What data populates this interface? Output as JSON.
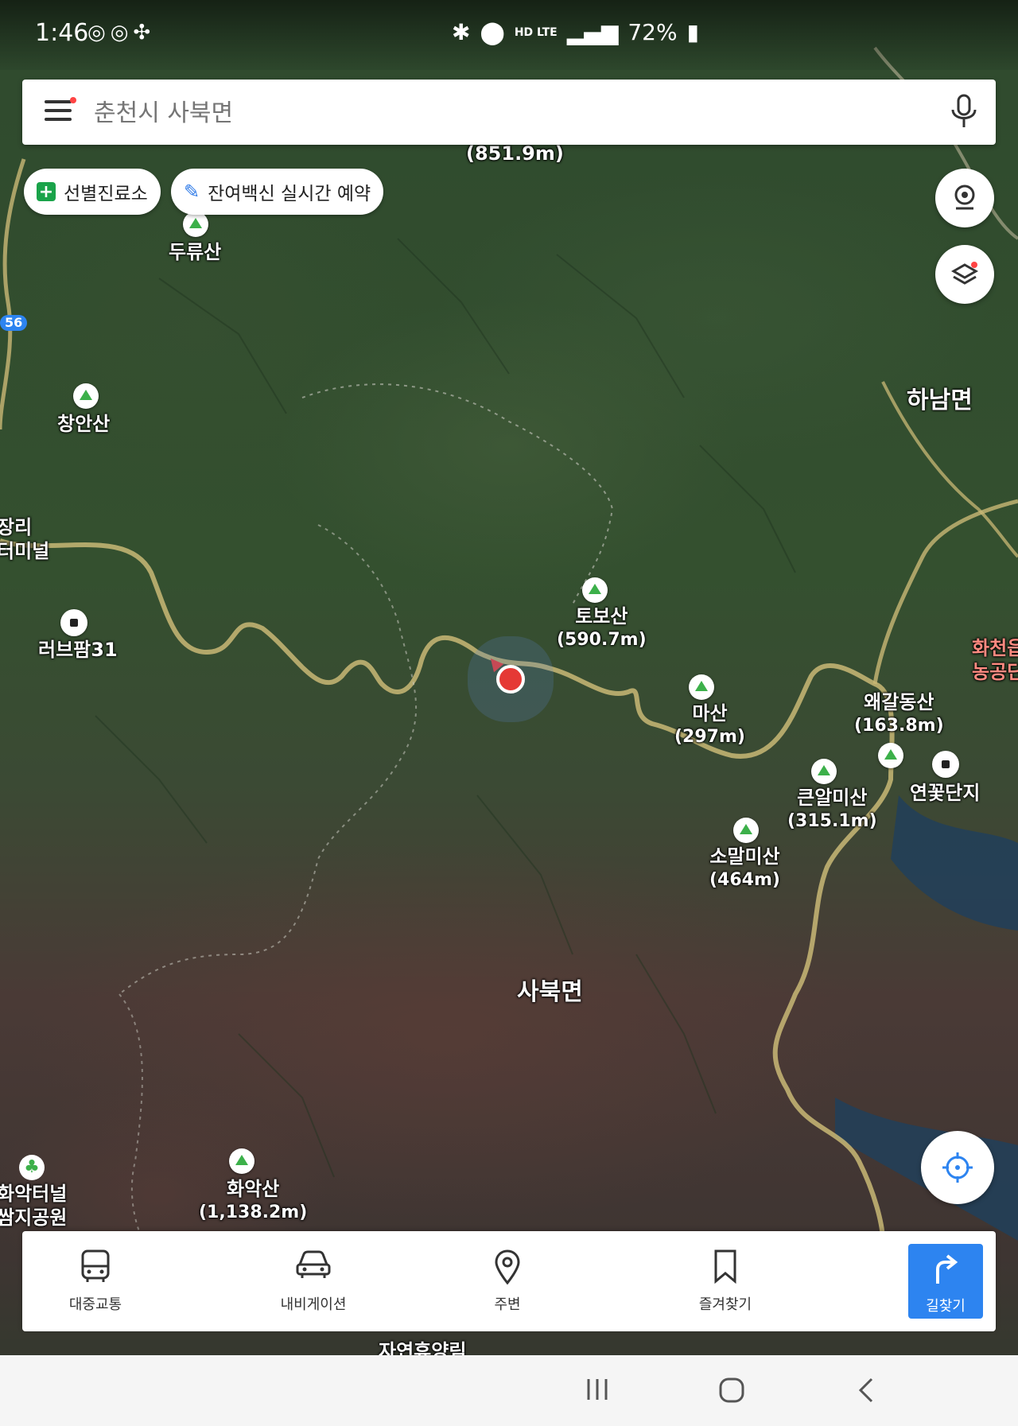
{
  "status_bar": {
    "time": "1:46",
    "left_icons": [
      "instagram-icon",
      "instagram-icon",
      "fan-icon"
    ],
    "network": "HD LTE",
    "battery": "72%"
  },
  "search": {
    "placeholder": "춘천시 사북면"
  },
  "chips": [
    {
      "label": "선별진료소",
      "icon": "plus-square-icon",
      "color": "#1aa34a"
    },
    {
      "label": "잔여백신 실시간 예약",
      "icon": "syringe-icon",
      "color": "#2f7be8"
    }
  ],
  "map_labels": {
    "top_peak_partial": "(851.9m)",
    "duryusan": "두류산",
    "changansan": "창안산",
    "hanam": "하남면",
    "terminal_partial_1": "장리",
    "terminal_partial_2": "터미널",
    "route_badge": "56",
    "lovefarm": "러브팜31",
    "tobosan": "토보산",
    "tobosan_elev": "(590.7m)",
    "masan": "마산",
    "masan_elev": "(297m)",
    "waegaldongsan": "왜갈동산",
    "waegaldongsan_elev": "(163.8m)",
    "hwacheon_partial_1": "화천읍",
    "hwacheon_partial_2": "농공단",
    "yeonkkot": "연꽃단지",
    "keunalmisan": "큰알미산",
    "keunalmisan_elev": "(315.1m)",
    "somalmisan": "소말미산",
    "somalmisan_elev": "(464m)",
    "sabuk": "사북면",
    "hwaaksan": "화악산",
    "hwaaksan_elev": "(1,138.2m)",
    "hwaak_tunnel_1": "화악터널",
    "hwaak_tunnel_2": "쌈지공원",
    "forest_partial": "자연휴양림"
  },
  "bottom_nav": [
    {
      "label": "대중교통",
      "icon": "bus-icon"
    },
    {
      "label": "내비게이션",
      "icon": "car-icon"
    },
    {
      "label": "주변",
      "icon": "location-pin-icon"
    },
    {
      "label": "즐겨찾기",
      "icon": "bookmark-icon"
    },
    {
      "label": "길찾기",
      "icon": "directions-arrow-icon",
      "color": "#2d84f0"
    }
  ],
  "system_nav": [
    "recent-apps-icon",
    "home-icon",
    "back-icon"
  ]
}
